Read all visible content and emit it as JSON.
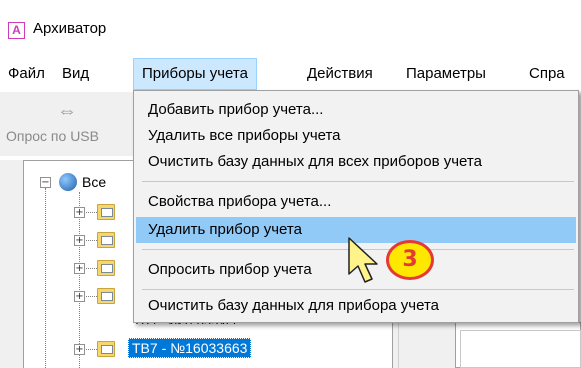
{
  "window": {
    "icon_letter": "A",
    "title": "Архиватор"
  },
  "menubar": {
    "items": [
      {
        "label": "Файл"
      },
      {
        "label": "Вид"
      },
      {
        "label": "Приборы учета"
      },
      {
        "label": "Действия"
      },
      {
        "label": "Параметры"
      },
      {
        "label": "Спра"
      }
    ],
    "active_index": 2
  },
  "toolbar": {
    "usb_icon": "usb-icon",
    "usb_label": "Опрос по USB"
  },
  "tree": {
    "root_label": "Все",
    "selected_label": "ТВ7 - №16033663",
    "partial_label": "ТВ7 - №16033455"
  },
  "dropdown": {
    "items": [
      {
        "label": "Добавить прибор учета..."
      },
      {
        "label": "Удалить все приборы учета"
      },
      {
        "label": "Очистить базу данных для всех приборов учета"
      },
      {
        "label": "Свойства прибора учета..."
      },
      {
        "label": "Удалить прибор учета"
      },
      {
        "label": "Опросить прибор учета"
      },
      {
        "label": "Очистить базу данных для прибора учета"
      }
    ],
    "highlighted_index": 4
  },
  "annotation": {
    "badge_number": "3"
  },
  "colors": {
    "menu_active_bg": "#cce8ff",
    "menu_highlight_bg": "#91c9f7",
    "selection_bg": "#0078d7",
    "badge_fill": "#ffe800",
    "badge_border": "#e53935"
  }
}
